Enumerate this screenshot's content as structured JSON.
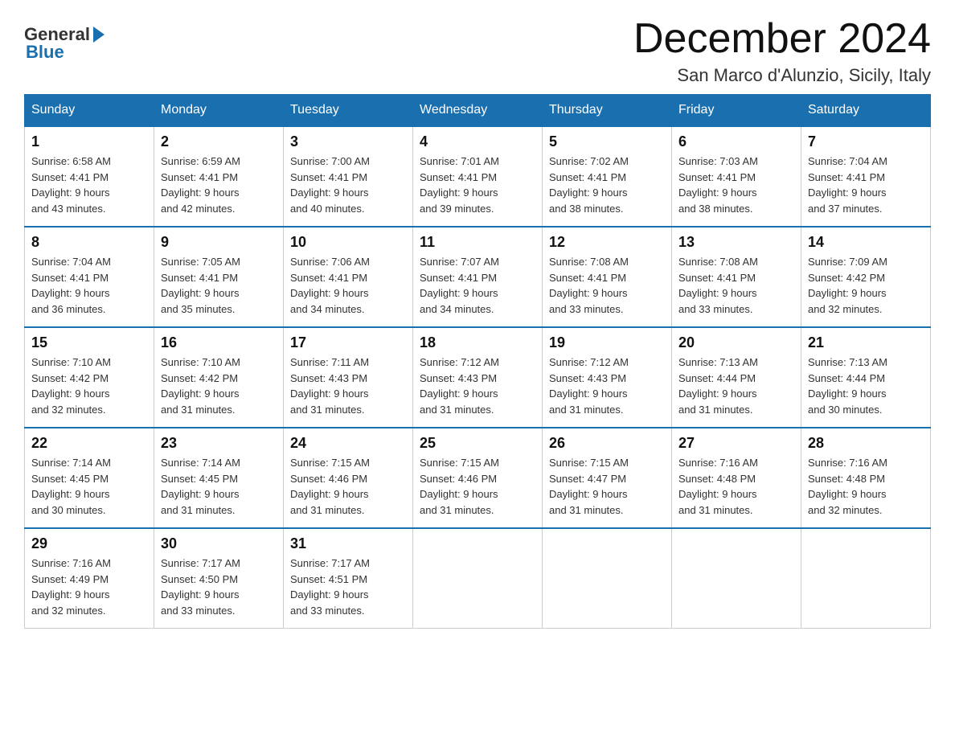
{
  "header": {
    "logo_general": "General",
    "logo_blue": "Blue",
    "month_title": "December 2024",
    "location": "San Marco d'Alunzio, Sicily, Italy"
  },
  "days_of_week": [
    "Sunday",
    "Monday",
    "Tuesday",
    "Wednesday",
    "Thursday",
    "Friday",
    "Saturday"
  ],
  "weeks": [
    [
      {
        "num": "1",
        "sunrise": "6:58 AM",
        "sunset": "4:41 PM",
        "daylight": "9 hours and 43 minutes."
      },
      {
        "num": "2",
        "sunrise": "6:59 AM",
        "sunset": "4:41 PM",
        "daylight": "9 hours and 42 minutes."
      },
      {
        "num": "3",
        "sunrise": "7:00 AM",
        "sunset": "4:41 PM",
        "daylight": "9 hours and 40 minutes."
      },
      {
        "num": "4",
        "sunrise": "7:01 AM",
        "sunset": "4:41 PM",
        "daylight": "9 hours and 39 minutes."
      },
      {
        "num": "5",
        "sunrise": "7:02 AM",
        "sunset": "4:41 PM",
        "daylight": "9 hours and 38 minutes."
      },
      {
        "num": "6",
        "sunrise": "7:03 AM",
        "sunset": "4:41 PM",
        "daylight": "9 hours and 38 minutes."
      },
      {
        "num": "7",
        "sunrise": "7:04 AM",
        "sunset": "4:41 PM",
        "daylight": "9 hours and 37 minutes."
      }
    ],
    [
      {
        "num": "8",
        "sunrise": "7:04 AM",
        "sunset": "4:41 PM",
        "daylight": "9 hours and 36 minutes."
      },
      {
        "num": "9",
        "sunrise": "7:05 AM",
        "sunset": "4:41 PM",
        "daylight": "9 hours and 35 minutes."
      },
      {
        "num": "10",
        "sunrise": "7:06 AM",
        "sunset": "4:41 PM",
        "daylight": "9 hours and 34 minutes."
      },
      {
        "num": "11",
        "sunrise": "7:07 AM",
        "sunset": "4:41 PM",
        "daylight": "9 hours and 34 minutes."
      },
      {
        "num": "12",
        "sunrise": "7:08 AM",
        "sunset": "4:41 PM",
        "daylight": "9 hours and 33 minutes."
      },
      {
        "num": "13",
        "sunrise": "7:08 AM",
        "sunset": "4:41 PM",
        "daylight": "9 hours and 33 minutes."
      },
      {
        "num": "14",
        "sunrise": "7:09 AM",
        "sunset": "4:42 PM",
        "daylight": "9 hours and 32 minutes."
      }
    ],
    [
      {
        "num": "15",
        "sunrise": "7:10 AM",
        "sunset": "4:42 PM",
        "daylight": "9 hours and 32 minutes."
      },
      {
        "num": "16",
        "sunrise": "7:10 AM",
        "sunset": "4:42 PM",
        "daylight": "9 hours and 31 minutes."
      },
      {
        "num": "17",
        "sunrise": "7:11 AM",
        "sunset": "4:43 PM",
        "daylight": "9 hours and 31 minutes."
      },
      {
        "num": "18",
        "sunrise": "7:12 AM",
        "sunset": "4:43 PM",
        "daylight": "9 hours and 31 minutes."
      },
      {
        "num": "19",
        "sunrise": "7:12 AM",
        "sunset": "4:43 PM",
        "daylight": "9 hours and 31 minutes."
      },
      {
        "num": "20",
        "sunrise": "7:13 AM",
        "sunset": "4:44 PM",
        "daylight": "9 hours and 31 minutes."
      },
      {
        "num": "21",
        "sunrise": "7:13 AM",
        "sunset": "4:44 PM",
        "daylight": "9 hours and 30 minutes."
      }
    ],
    [
      {
        "num": "22",
        "sunrise": "7:14 AM",
        "sunset": "4:45 PM",
        "daylight": "9 hours and 30 minutes."
      },
      {
        "num": "23",
        "sunrise": "7:14 AM",
        "sunset": "4:45 PM",
        "daylight": "9 hours and 31 minutes."
      },
      {
        "num": "24",
        "sunrise": "7:15 AM",
        "sunset": "4:46 PM",
        "daylight": "9 hours and 31 minutes."
      },
      {
        "num": "25",
        "sunrise": "7:15 AM",
        "sunset": "4:46 PM",
        "daylight": "9 hours and 31 minutes."
      },
      {
        "num": "26",
        "sunrise": "7:15 AM",
        "sunset": "4:47 PM",
        "daylight": "9 hours and 31 minutes."
      },
      {
        "num": "27",
        "sunrise": "7:16 AM",
        "sunset": "4:48 PM",
        "daylight": "9 hours and 31 minutes."
      },
      {
        "num": "28",
        "sunrise": "7:16 AM",
        "sunset": "4:48 PM",
        "daylight": "9 hours and 32 minutes."
      }
    ],
    [
      {
        "num": "29",
        "sunrise": "7:16 AM",
        "sunset": "4:49 PM",
        "daylight": "9 hours and 32 minutes."
      },
      {
        "num": "30",
        "sunrise": "7:17 AM",
        "sunset": "4:50 PM",
        "daylight": "9 hours and 33 minutes."
      },
      {
        "num": "31",
        "sunrise": "7:17 AM",
        "sunset": "4:51 PM",
        "daylight": "9 hours and 33 minutes."
      },
      null,
      null,
      null,
      null
    ]
  ],
  "labels": {
    "sunrise": "Sunrise:",
    "sunset": "Sunset:",
    "daylight": "Daylight:"
  }
}
